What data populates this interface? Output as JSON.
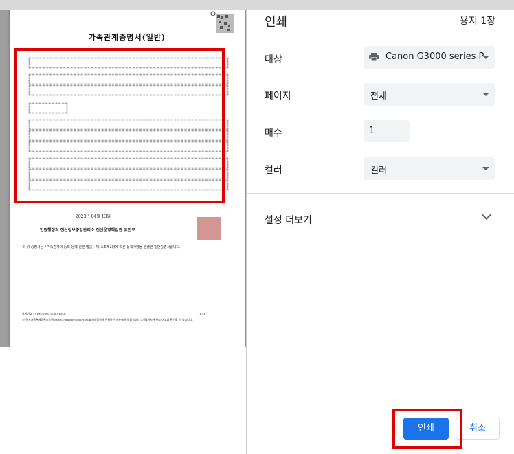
{
  "panel": {
    "title": "인쇄",
    "sheet_count": "용지 1장",
    "destination_label": "대상",
    "destination_value": "Canon G3000 series P",
    "pages_label": "페이지",
    "pages_value": "전체",
    "copies_label": "매수",
    "copies_value": "1",
    "color_label": "컬러",
    "color_value": "컬러",
    "more_settings": "설정 더보기",
    "print_button": "인쇄",
    "cancel_button": "취소"
  },
  "document": {
    "title": "가족관계증명서(일반)",
    "date": "2023년 04월 13일",
    "issuer": "법원행정처 전산정보중앙관리소 전산운영책임관 유진오",
    "notice": "※ 위 증명서는「가족관계의 등록 등에 관한 법률」제15조제2항에 따른 등록사항을 현출한 일반증명서입니다.",
    "footer_number": "발행번호 : 9194-2003-3000-1546",
    "footer_page": "1 / 1",
    "footer_note": "※ 전자가족관계등록시스템(https://efamily.scourt.go.kr)의 증명서 진위확인 메뉴에서 발급일부터 3개월까지 위변조 여부를 확인할 수 있습니다."
  },
  "colors": {
    "accent": "#1a73e8",
    "highlight": "#e00000",
    "panel_field": "#f1f3f4"
  },
  "icons": {
    "printer": "printer-icon",
    "chevron": "chevron-down-icon"
  }
}
